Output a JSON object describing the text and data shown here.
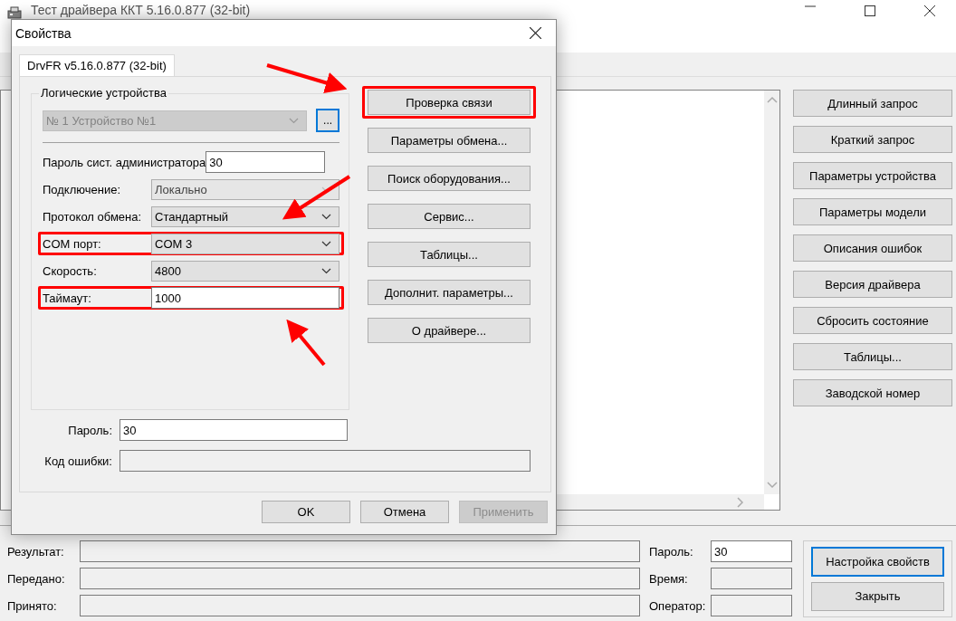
{
  "main_window": {
    "title": "Тест драйвера ККТ 5.16.0.877 (32-bit)",
    "side_buttons": [
      "Длинный запрос",
      "Краткий запрос",
      "Параметры устройства",
      "Параметры модели",
      "Описания ошибок",
      "Версия драйвера",
      "Сбросить состояние",
      "Таблицы...",
      "Заводской номер"
    ],
    "status_fields": [
      {
        "label": "Результат:"
      },
      {
        "label": "Передано:"
      },
      {
        "label": "Принято:"
      }
    ],
    "password": {
      "label": "Пароль:",
      "value": "30"
    },
    "time": {
      "label": "Время:"
    },
    "operator": {
      "label": "Оператор:"
    },
    "buttons": [
      {
        "label": "Настройка свойств",
        "focused": true
      },
      {
        "label": "Закрыть",
        "focused": false
      }
    ]
  },
  "dialog": {
    "title": "Свойства",
    "tabs": [
      {
        "label": "DrvFR v5.16.0.877 (32-bit)",
        "selected": true
      }
    ],
    "group": {
      "title": "Логические устройства",
      "device": {
        "value": "№ 1 Устройство №1",
        "disabled": true
      },
      "browse_button": "...",
      "fields": [
        {
          "kind": "text",
          "label": "Пароль сист. администратора",
          "value": "30",
          "annotated": false
        },
        {
          "kind": "combo",
          "label": "Подключение:",
          "value": "Локально",
          "disabled": true,
          "annotated": false
        },
        {
          "kind": "combo",
          "label": "Протокол обмена:",
          "value": "Стандартный",
          "disabled": false,
          "annotated": false
        },
        {
          "kind": "combo",
          "label": "COM порт:",
          "value": "COM 3",
          "disabled": false,
          "annotated": true
        },
        {
          "kind": "combo",
          "label": "Скорость:",
          "value": "4800",
          "disabled": false,
          "annotated": false
        },
        {
          "kind": "text",
          "label": "Таймаут:",
          "value": "1000",
          "annotated": true
        }
      ]
    },
    "actions": [
      {
        "label": "Проверка связи",
        "annotated": true
      },
      {
        "label": "Параметры обмена...",
        "annotated": false
      },
      {
        "label": "Поиск оборудования...",
        "annotated": false
      },
      {
        "label": "Сервис...",
        "annotated": false
      },
      {
        "label": "Таблицы...",
        "annotated": false
      },
      {
        "label": "Дополнит. параметры...",
        "annotated": false
      },
      {
        "label": "О драйвере...",
        "annotated": false
      }
    ],
    "password": {
      "label": "Пароль:",
      "value": "30"
    },
    "error_code": {
      "label": "Код ошибки:"
    },
    "footer_buttons": [
      {
        "label": "OK",
        "disabled": false
      },
      {
        "label": "Отмена",
        "disabled": false
      },
      {
        "label": "Применить",
        "disabled": true
      }
    ]
  }
}
